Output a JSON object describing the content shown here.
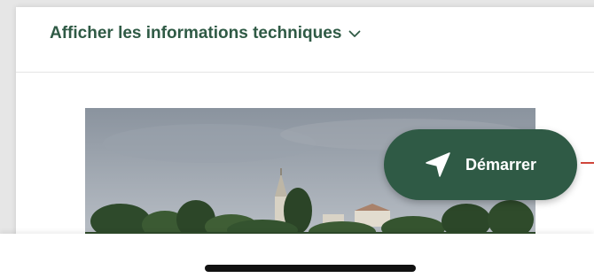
{
  "tech_info": {
    "label": "Afficher les informations techniques",
    "icon": "chevron-down-icon"
  },
  "photo": {
    "description_icon": "village-church-photo"
  },
  "start_button": {
    "label": "Démarrer",
    "icon": "navigation-arrow-icon"
  },
  "colors": {
    "accent": "#2f5a45",
    "edge_marker": "#d0463b"
  }
}
